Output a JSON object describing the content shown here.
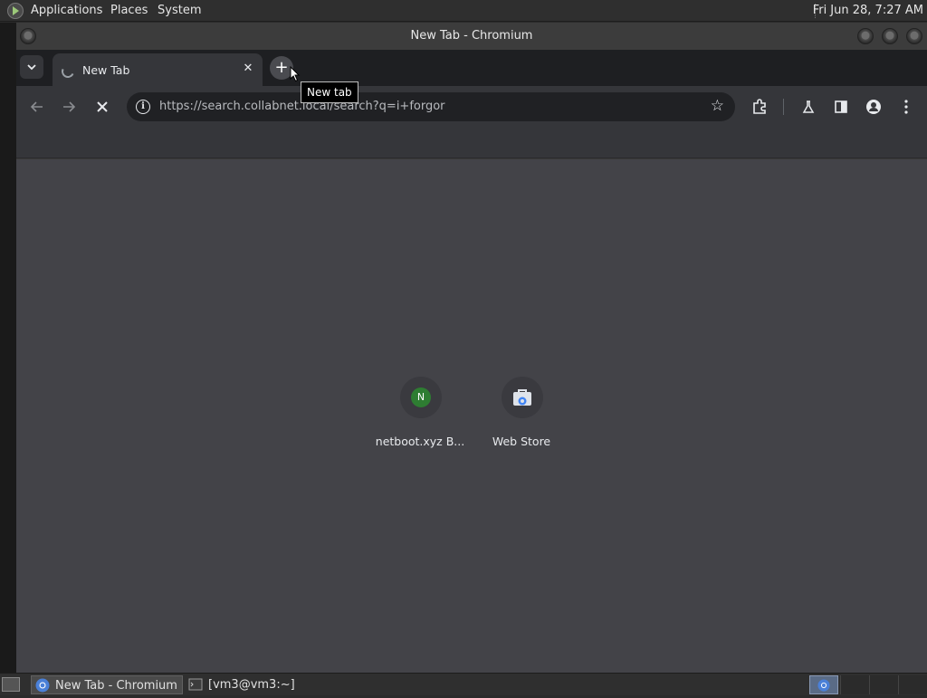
{
  "topbar": {
    "menus": [
      "Applications",
      "Places",
      "System"
    ],
    "clock": "Fri Jun 28,  7:27 AM"
  },
  "window": {
    "title": "New Tab - Chromium"
  },
  "browser": {
    "tab_title": "New Tab",
    "new_tab_tooltip": "New tab",
    "url": "https://search.collabnet.local/search?q=i+forgor",
    "shortcuts": [
      {
        "title": "netboot.xyz B...",
        "badge": "N",
        "icon": "letter-badge-icon"
      },
      {
        "title": "Web Store",
        "icon": "web-store-icon"
      }
    ],
    "colors": {
      "accent_green": "#2e7d32",
      "content_bg": "#434348",
      "toolbar_bg": "#35363a"
    }
  },
  "taskbar": {
    "items": [
      {
        "label": "New Tab - Chromium",
        "icon": "chromium-icon",
        "active": true
      },
      {
        "label": "[vm3@vm3:~]",
        "icon": "terminal-icon",
        "active": false
      }
    ]
  }
}
